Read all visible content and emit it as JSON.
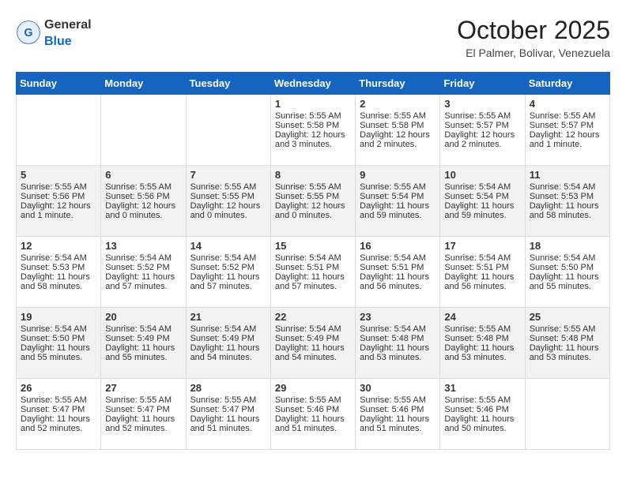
{
  "header": {
    "logo_general": "General",
    "logo_blue": "Blue",
    "month_title": "October 2025",
    "location": "El Palmer, Bolivar, Venezuela"
  },
  "weekdays": [
    "Sunday",
    "Monday",
    "Tuesday",
    "Wednesday",
    "Thursday",
    "Friday",
    "Saturday"
  ],
  "weeks": [
    [
      {
        "day": "",
        "content": ""
      },
      {
        "day": "",
        "content": ""
      },
      {
        "day": "",
        "content": ""
      },
      {
        "day": "1",
        "content": "Sunrise: 5:55 AM\nSunset: 5:58 PM\nDaylight: 12 hours and 3 minutes."
      },
      {
        "day": "2",
        "content": "Sunrise: 5:55 AM\nSunset: 5:58 PM\nDaylight: 12 hours and 2 minutes."
      },
      {
        "day": "3",
        "content": "Sunrise: 5:55 AM\nSunset: 5:57 PM\nDaylight: 12 hours and 2 minutes."
      },
      {
        "day": "4",
        "content": "Sunrise: 5:55 AM\nSunset: 5:57 PM\nDaylight: 12 hours and 1 minute."
      }
    ],
    [
      {
        "day": "5",
        "content": "Sunrise: 5:55 AM\nSunset: 5:56 PM\nDaylight: 12 hours and 1 minute."
      },
      {
        "day": "6",
        "content": "Sunrise: 5:55 AM\nSunset: 5:56 PM\nDaylight: 12 hours and 0 minutes."
      },
      {
        "day": "7",
        "content": "Sunrise: 5:55 AM\nSunset: 5:55 PM\nDaylight: 12 hours and 0 minutes."
      },
      {
        "day": "8",
        "content": "Sunrise: 5:55 AM\nSunset: 5:55 PM\nDaylight: 12 hours and 0 minutes."
      },
      {
        "day": "9",
        "content": "Sunrise: 5:55 AM\nSunset: 5:54 PM\nDaylight: 11 hours and 59 minutes."
      },
      {
        "day": "10",
        "content": "Sunrise: 5:54 AM\nSunset: 5:54 PM\nDaylight: 11 hours and 59 minutes."
      },
      {
        "day": "11",
        "content": "Sunrise: 5:54 AM\nSunset: 5:53 PM\nDaylight: 11 hours and 58 minutes."
      }
    ],
    [
      {
        "day": "12",
        "content": "Sunrise: 5:54 AM\nSunset: 5:53 PM\nDaylight: 11 hours and 58 minutes."
      },
      {
        "day": "13",
        "content": "Sunrise: 5:54 AM\nSunset: 5:52 PM\nDaylight: 11 hours and 57 minutes."
      },
      {
        "day": "14",
        "content": "Sunrise: 5:54 AM\nSunset: 5:52 PM\nDaylight: 11 hours and 57 minutes."
      },
      {
        "day": "15",
        "content": "Sunrise: 5:54 AM\nSunset: 5:51 PM\nDaylight: 11 hours and 57 minutes."
      },
      {
        "day": "16",
        "content": "Sunrise: 5:54 AM\nSunset: 5:51 PM\nDaylight: 11 hours and 56 minutes."
      },
      {
        "day": "17",
        "content": "Sunrise: 5:54 AM\nSunset: 5:51 PM\nDaylight: 11 hours and 56 minutes."
      },
      {
        "day": "18",
        "content": "Sunrise: 5:54 AM\nSunset: 5:50 PM\nDaylight: 11 hours and 55 minutes."
      }
    ],
    [
      {
        "day": "19",
        "content": "Sunrise: 5:54 AM\nSunset: 5:50 PM\nDaylight: 11 hours and 55 minutes."
      },
      {
        "day": "20",
        "content": "Sunrise: 5:54 AM\nSunset: 5:49 PM\nDaylight: 11 hours and 55 minutes."
      },
      {
        "day": "21",
        "content": "Sunrise: 5:54 AM\nSunset: 5:49 PM\nDaylight: 11 hours and 54 minutes."
      },
      {
        "day": "22",
        "content": "Sunrise: 5:54 AM\nSunset: 5:49 PM\nDaylight: 11 hours and 54 minutes."
      },
      {
        "day": "23",
        "content": "Sunrise: 5:54 AM\nSunset: 5:48 PM\nDaylight: 11 hours and 53 minutes."
      },
      {
        "day": "24",
        "content": "Sunrise: 5:55 AM\nSunset: 5:48 PM\nDaylight: 11 hours and 53 minutes."
      },
      {
        "day": "25",
        "content": "Sunrise: 5:55 AM\nSunset: 5:48 PM\nDaylight: 11 hours and 53 minutes."
      }
    ],
    [
      {
        "day": "26",
        "content": "Sunrise: 5:55 AM\nSunset: 5:47 PM\nDaylight: 11 hours and 52 minutes."
      },
      {
        "day": "27",
        "content": "Sunrise: 5:55 AM\nSunset: 5:47 PM\nDaylight: 11 hours and 52 minutes."
      },
      {
        "day": "28",
        "content": "Sunrise: 5:55 AM\nSunset: 5:47 PM\nDaylight: 11 hours and 51 minutes."
      },
      {
        "day": "29",
        "content": "Sunrise: 5:55 AM\nSunset: 5:46 PM\nDaylight: 11 hours and 51 minutes."
      },
      {
        "day": "30",
        "content": "Sunrise: 5:55 AM\nSunset: 5:46 PM\nDaylight: 11 hours and 51 minutes."
      },
      {
        "day": "31",
        "content": "Sunrise: 5:55 AM\nSunset: 5:46 PM\nDaylight: 11 hours and 50 minutes."
      },
      {
        "day": "",
        "content": ""
      }
    ]
  ]
}
